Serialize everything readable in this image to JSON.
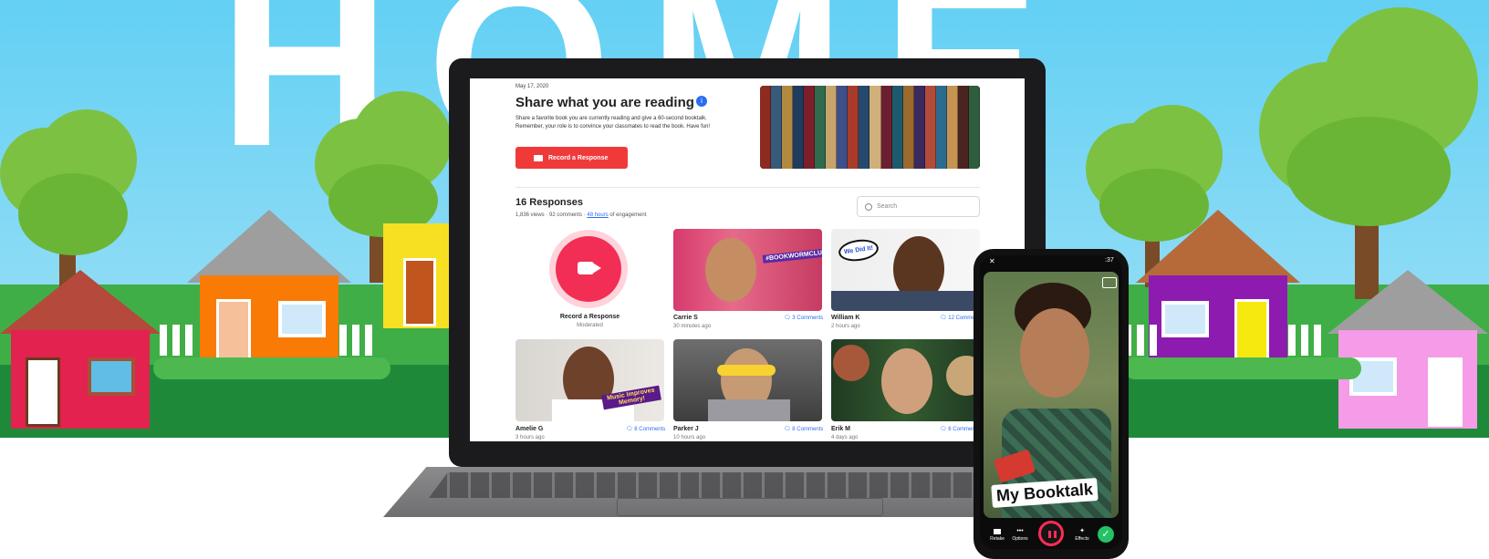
{
  "background": {
    "headline": "HOME",
    "sky_color": "#63d0f4",
    "grass_color": "#3fae47"
  },
  "prompt": {
    "date": "May 17, 2020",
    "title": "Share what you are reading",
    "description": "Share a favorite book you are currently reading and give a 60-second booktalk. Remember, your role is to convince your classmates to read the book. Have fun!",
    "record_label": "Record a Response"
  },
  "responses": {
    "heading": "16 Responses",
    "stats_prefix": "1,836 views · 92 comments · ",
    "stats_link": "48 hours",
    "stats_suffix": " of engagement",
    "search_placeholder": "Search",
    "record_tile": {
      "label": "Record a Response",
      "sub": "Moderated"
    },
    "tiles": [
      {
        "name": "Carrie S",
        "time": "30 minutes ago",
        "comments": "3 Comments",
        "sticker": "#BOOKWORMCLUB"
      },
      {
        "name": "William K",
        "time": "2 hours ago",
        "comments": "12 Comments",
        "sticker": "We Did It!"
      },
      {
        "name": "Amelie G",
        "time": "3 hours ago",
        "comments": "8 Comments",
        "sticker": "Music Improves Memory!"
      },
      {
        "name": "Parker J",
        "time": "10 hours ago",
        "comments": "8 Comments"
      },
      {
        "name": "Erik M",
        "time": "4 days ago",
        "comments": "6 Comments"
      }
    ]
  },
  "phone": {
    "close": "✕",
    "timer": ":37",
    "title_sticker": "My Booktalk",
    "controls": {
      "retake": "Retake",
      "options": "Options",
      "effects": "Effects"
    }
  },
  "colors": {
    "accent_red": "#f03a3a",
    "link_blue": "#2a6ef0",
    "record_pink": "#f22e55",
    "confirm_green": "#23c264"
  }
}
